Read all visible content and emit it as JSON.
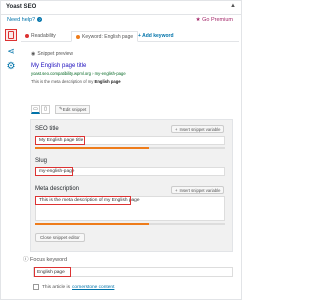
{
  "header": {
    "title": "Yoast SEO",
    "collapse_icon": "caret-up-icon",
    "collapse_glyph": "▲"
  },
  "help": {
    "label": "Need help?",
    "premium_label": "Go Premium"
  },
  "tabs": [
    {
      "label": "Readability",
      "status_color": "#dc3232"
    },
    {
      "label": "Keyword: English page",
      "status_color": "#ee7c1b"
    },
    {
      "label": "+ Add keyword"
    }
  ],
  "snippet": {
    "section_label": "Snippet preview",
    "title": "My English page title",
    "url": "yoast.seo.compatibility.wpml.org › my-english-page",
    "desc_before": "This is the meta description of my ",
    "desc_bold": "English page",
    "edit_label": "Edit snippet"
  },
  "editor": {
    "seo_title_label": "SEO title",
    "seo_title_value": "My English page title",
    "slug_label": "Slug",
    "slug_value": "my-english-page",
    "meta_label": "Meta description",
    "meta_value": "This is the meta description of my English page",
    "insert_label": "Insert snippet variable",
    "close_label": "Close snippet editor",
    "seo_title_progress": 0.6,
    "meta_progress": 0.6
  },
  "focus": {
    "label": "Focus keyword",
    "value": "English page",
    "cornerstone_text": "This article is",
    "cornerstone_link": "cornerstone content"
  },
  "colors": {
    "accent": "#0073aa",
    "error": "#dc3232",
    "warning": "#ee7c1b",
    "premium": "#a4286a"
  }
}
